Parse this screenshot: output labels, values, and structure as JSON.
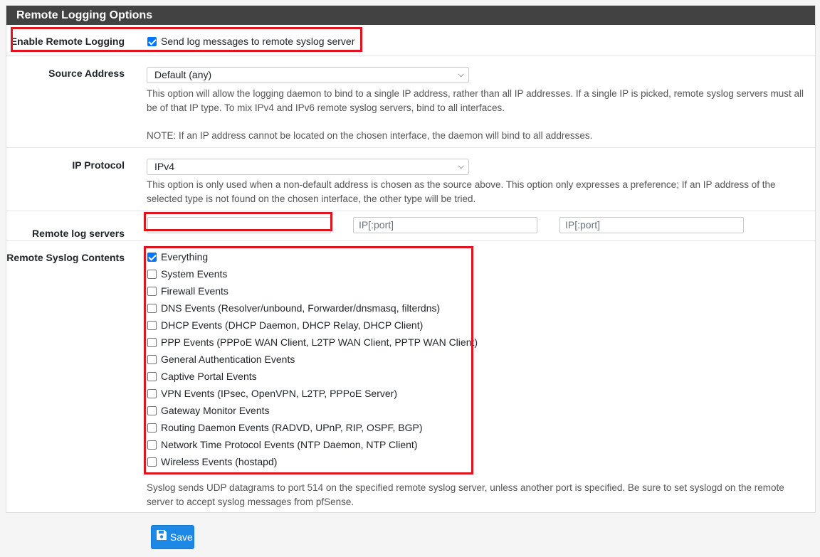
{
  "panel": {
    "title": "Remote Logging Options"
  },
  "enable_remote": {
    "label": "Enable Remote Logging",
    "checkbox_label": "Send log messages to remote syslog server",
    "checked": true
  },
  "source_address": {
    "label": "Source Address",
    "selected": "Default (any)",
    "help1": "This option will allow the logging daemon to bind to a single IP address, rather than all IP addresses. If a single IP is picked, remote syslog servers must all be of that IP type. To mix IPv4 and IPv6 remote syslog servers, bind to all interfaces.",
    "help2": "NOTE: If an IP address cannot be located on the chosen interface, the daemon will bind to all addresses."
  },
  "ip_protocol": {
    "label": "IP Protocol",
    "selected": "IPv4",
    "help": "This option is only used when a non-default address is chosen as the source above. This option only expresses a preference; If an IP address of the selected type is not found on the chosen interface, the other type will be tried."
  },
  "remote_servers": {
    "label": "Remote log servers",
    "server1_value": "",
    "server2_placeholder": "IP[:port]",
    "server3_placeholder": "IP[:port]"
  },
  "syslog_contents": {
    "label": "Remote Syslog Contents",
    "items": [
      {
        "label": "Everything",
        "checked": true
      },
      {
        "label": "System Events",
        "checked": false
      },
      {
        "label": "Firewall Events",
        "checked": false
      },
      {
        "label": "DNS Events (Resolver/unbound, Forwarder/dnsmasq, filterdns)",
        "checked": false
      },
      {
        "label": "DHCP Events (DHCP Daemon, DHCP Relay, DHCP Client)",
        "checked": false
      },
      {
        "label": "PPP Events (PPPoE WAN Client, L2TP WAN Client, PPTP WAN Client)",
        "checked": false
      },
      {
        "label": "General Authentication Events",
        "checked": false
      },
      {
        "label": "Captive Portal Events",
        "checked": false
      },
      {
        "label": "VPN Events (IPsec, OpenVPN, L2TP, PPPoE Server)",
        "checked": false
      },
      {
        "label": "Gateway Monitor Events",
        "checked": false
      },
      {
        "label": "Routing Daemon Events (RADVD, UPnP, RIP, OSPF, BGP)",
        "checked": false
      },
      {
        "label": "Network Time Protocol Events (NTP Daemon, NTP Client)",
        "checked": false
      },
      {
        "label": "Wireless Events (hostapd)",
        "checked": false
      }
    ],
    "help": "Syslog sends UDP datagrams to port 514 on the specified remote syslog server, unless another port is specified. Be sure to set syslogd on the remote server to accept syslog messages from pfSense."
  },
  "save_button": {
    "label": "Save",
    "icon": "floppy-disk-icon"
  },
  "colors": {
    "heading_bg": "#424242",
    "highlight": "#e0141e",
    "primary": "#1e88e5",
    "checkbox": "#0075ff"
  }
}
